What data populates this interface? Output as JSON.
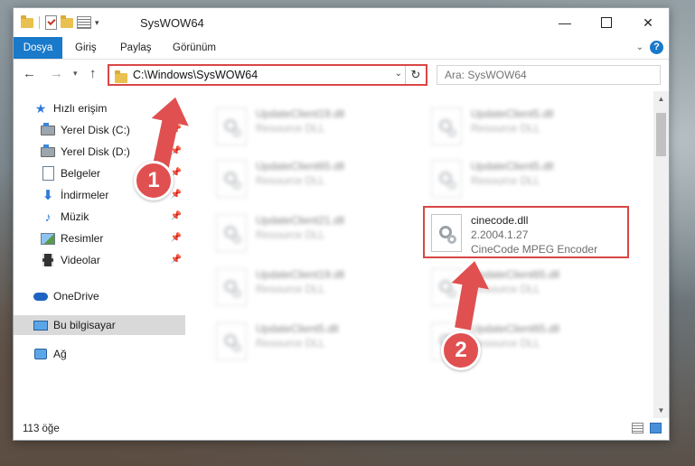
{
  "window": {
    "title": "SysWOW64"
  },
  "ribbon": {
    "tabs": [
      "Dosya",
      "Giriş",
      "Paylaş",
      "Görünüm"
    ],
    "help": "?"
  },
  "address": {
    "path": "C:\\Windows\\SysWOW64",
    "search_placeholder": "Ara: SysWOW64"
  },
  "sidebar": {
    "quick_access": "Hızlı erişim",
    "items": [
      {
        "label": "Yerel Disk (C:)",
        "icon": "drive-icon"
      },
      {
        "label": "Yerel Disk (D:)",
        "icon": "drive-icon"
      },
      {
        "label": "Belgeler",
        "icon": "documents-icon"
      },
      {
        "label": "İndirmeler",
        "icon": "downloads-icon"
      },
      {
        "label": "Müzik",
        "icon": "music-icon"
      },
      {
        "label": "Resimler",
        "icon": "pictures-icon"
      },
      {
        "label": "Videolar",
        "icon": "videos-icon"
      }
    ],
    "onedrive": "OneDrive",
    "this_pc": "Bu bilgisayar",
    "network": "Ağ"
  },
  "files": [
    {
      "name": "UpdateClient19.dll",
      "line2": "Resource DLL",
      "line3": ""
    },
    {
      "name": "UpdateClient5.dll",
      "line2": "Resource DLL",
      "line3": ""
    },
    {
      "name": "UpdateClient65.dll",
      "line2": "Resource DLL",
      "line3": ""
    },
    {
      "name": "UpdateClient5.dll",
      "line2": "Resource DLL",
      "line3": ""
    },
    {
      "name": "UpdateClient21.dll",
      "line2": "Resource DLL",
      "line3": ""
    },
    {
      "name": "cinecode.dll",
      "line2": "2.2004.1.27",
      "line3": "CineCode MPEG Encoder"
    },
    {
      "name": "UpdateClient19.dll",
      "line2": "Resource DLL",
      "line3": ""
    },
    {
      "name": "UpdateClient65.dll",
      "line2": "Resource DLL",
      "line3": ""
    },
    {
      "name": "UpdateClient5.dll",
      "line2": "Resource DLL",
      "line3": ""
    },
    {
      "name": "UpdateClient65.dll",
      "line2": "Resource DLL",
      "line3": ""
    }
  ],
  "status": {
    "item_count": "113 öğe"
  },
  "callouts": {
    "step1": "1",
    "step2": "2"
  },
  "colors": {
    "accent": "#1979ca",
    "callout": "#e05050",
    "highlight": "#d94646"
  }
}
